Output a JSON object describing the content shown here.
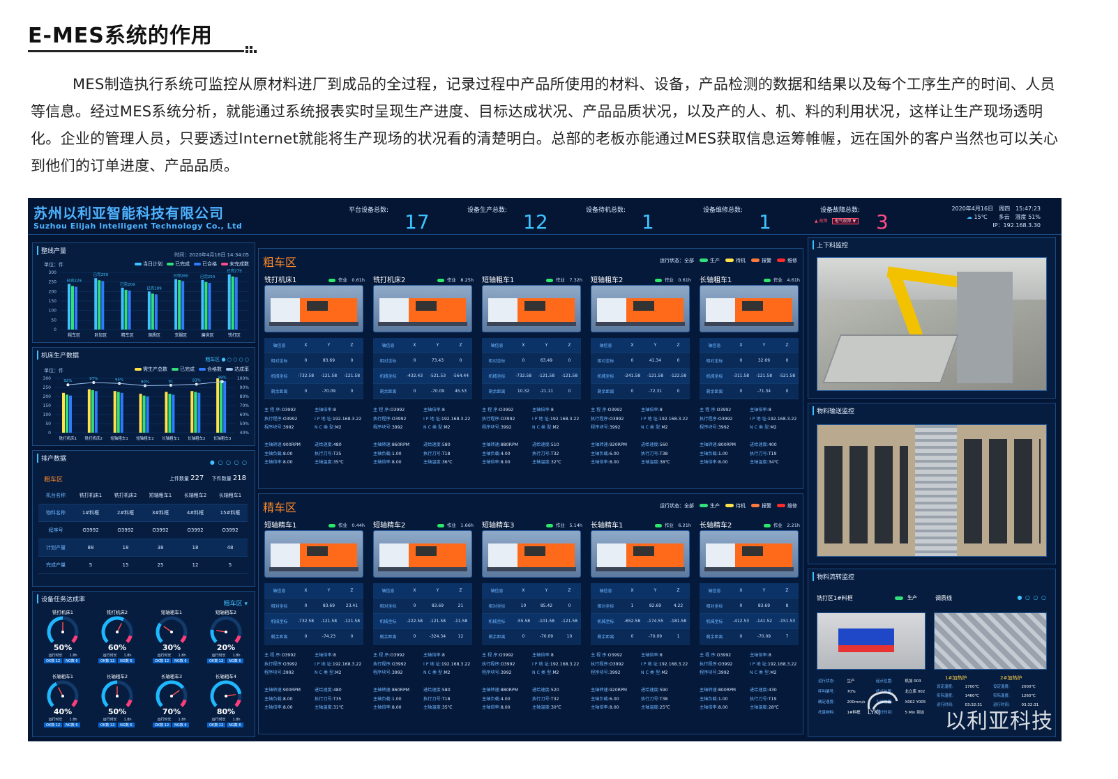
{
  "header": {
    "title": "E-MES系统的作用",
    "paragraph": "MES制造执行系统可监控从原材料进厂到成品的全过程，记录过程中产品所使用的材料、设备，产品检测的数据和结果以及每个工序生产的时间、人员等信息。经过MES系统分析，就能通过系统报表实时呈现生产进度、目标达成状况、产品品质状况，以及产的人、机、料的利用状况，这样让生产现场透明化。企业的管理人员，只要透过Internet就能将生产现场的状况看的清楚明白。总部的老板亦能通过MES获取信息运筹帷幄，远在国外的客户当然也可以关心到他们的订单进度、产品品质。"
  },
  "dashboard": {
    "company_cn": "苏州以利亚智能科技有限公司",
    "company_en": "Suzhou Elijah Intelligent Technology Co., Ltd",
    "stats": [
      {
        "label": "平台设备总数:",
        "value": "17",
        "color": "#3ec3ff"
      },
      {
        "label": "设备生产总数:",
        "value": "12",
        "color": "#3ec3ff"
      },
      {
        "label": "设备待机总数:",
        "value": "1",
        "color": "#3ec3ff"
      },
      {
        "label": "设备维修总数:",
        "value": "1",
        "color": "#3ec3ff"
      },
      {
        "label": "设备故障总数:",
        "value": "3",
        "color": "#ff4d8a"
      }
    ],
    "fault_tag": "故障",
    "fault_sel": "电气故障 ▼",
    "datetime": "2020年4月16日　周四　15:47:23",
    "weather": "15℃　　多云　湿度 51%",
    "ip": "IP：192.168.3.30",
    "output_panel": {
      "title": "整线产量",
      "time": "时间：2020年4月16日 14:34:05",
      "unit": "单位：件",
      "legend": [
        {
          "name": "当日计划",
          "color": "#3ec3ff"
        },
        {
          "name": "已完成",
          "color": "#31e07a"
        },
        {
          "name": "已合格",
          "color": "#2f7bff"
        },
        {
          "name": "未完成数",
          "color": "#ff4d8a"
        }
      ],
      "chart_data": {
        "type": "bar",
        "categories": [
          "粗车区",
          "卧加区",
          "精车区",
          "调质区",
          "支腿区",
          "磨床区",
          "铣打区"
        ],
        "series": [
          {
            "name": "当日计划",
            "values": [
              240,
              270,
              220,
              200,
              265,
              260,
              290
            ]
          },
          {
            "name": "已完成",
            "values": [
              229,
              259,
              209,
              189,
              260,
              250,
              279
            ]
          },
          {
            "name": "已合格",
            "values": [
              225,
              255,
              205,
              185,
              255,
              245,
              275
            ]
          }
        ],
        "labels": [
          "已完229",
          "已完259",
          "已完209",
          "已完189",
          "已完260",
          "已完250",
          "已完279"
        ],
        "yticks": [
          "300",
          "250",
          "200",
          "150",
          "100",
          "50",
          "0"
        ],
        "ylim": [
          0,
          300
        ]
      }
    },
    "machine_panel": {
      "title": "机床生产数据",
      "zone": "粗车区",
      "unit": "单位：件",
      "legend": [
        {
          "name": "需生产总数",
          "color": "#ffe14a"
        },
        {
          "name": "已完成",
          "color": "#31e07a"
        },
        {
          "name": "合格数",
          "color": "#2f7bff"
        },
        {
          "name": "达成率",
          "color": "#9fc3ee"
        }
      ],
      "chart_data": {
        "type": "bar",
        "categories": [
          "铣打机床1",
          "铣打机床2",
          "短轴粗车1",
          "短轴粗车2",
          "长轴粗车1",
          "长轴粗车2",
          "长轴粗车3"
        ],
        "series": [
          {
            "name": "需生产总数",
            "values": [
              220,
              240,
              230,
              215,
              225,
              230,
              300
            ]
          },
          {
            "name": "已完成",
            "values": [
              210,
              235,
              225,
              205,
              215,
              225,
              290
            ]
          },
          {
            "name": "合格数",
            "values": [
              205,
              230,
              220,
              200,
              210,
              220,
              285
            ]
          }
        ],
        "rate": [
          "92%",
          "97%",
          "95%",
          "90%",
          "91",
          "93%",
          "99%"
        ],
        "rate_values": [
          92,
          97,
          95,
          90,
          91,
          93,
          99
        ],
        "yticks": [
          "300",
          "250",
          "200",
          "150",
          "100",
          "50",
          "0"
        ],
        "y2ticks": [
          "100%",
          "90%",
          "80%",
          "70%",
          "60%",
          "50%",
          "40%"
        ]
      }
    },
    "schedule_panel": {
      "title": "排产数据",
      "zone": "粗车区",
      "in_label": "上件数量",
      "in_val": "227",
      "out_label": "下件数量",
      "out_val": "218",
      "rows": [
        [
          "机台名称",
          "铣打机床1",
          "铣打机床2",
          "短轴粗车1",
          "长轴粗车2",
          "长轴粗车1"
        ],
        [
          "物料名称",
          "1#料框",
          "2#料框",
          "3#料框",
          "4#料框",
          "15#料框"
        ],
        [
          "程序号",
          "O3992",
          "O3992",
          "O3992",
          "O3992",
          "O3992"
        ],
        [
          "计划产量",
          "88",
          "18",
          "38",
          "18",
          "48"
        ],
        [
          "完成产量",
          "5",
          "15",
          "25",
          "12",
          "5"
        ]
      ]
    },
    "gauge_panel": {
      "title": "设备任务达成率",
      "zone": "粗车区 ▾",
      "gauges": [
        {
          "name": "铣打机床1",
          "pct": "50%",
          "v": 50
        },
        {
          "name": "铣打机床2",
          "pct": "60%",
          "v": 60
        },
        {
          "name": "短轴粗车1",
          "pct": "30%",
          "v": 30
        },
        {
          "name": "短轴粗车2",
          "pct": "20%",
          "v": 20
        },
        {
          "name": "长轴粗车1",
          "pct": "40%",
          "v": 40
        },
        {
          "name": "长轴粗车2",
          "pct": "50%",
          "v": 50
        },
        {
          "name": "长轴粗车3",
          "pct": "70%",
          "v": 70
        },
        {
          "name": "长轴粗车4",
          "pct": "80%",
          "v": 80
        }
      ],
      "time_text": "运行时长　　1.8h",
      "ok": "OK数 12",
      "ng": "NG数 6"
    },
    "zones": [
      {
        "title": "粗车区",
        "status": "运行状态：全部",
        "leg": [
          {
            "n": "生产",
            "c": "#31e07a"
          },
          {
            "n": "待机",
            "c": "#ffe14a"
          },
          {
            "n": "报警",
            "c": "#ff7a3a"
          },
          {
            "n": "维修",
            "c": "#ff2a2a"
          }
        ],
        "machines": [
          {
            "name": "铣打机床1",
            "state": "作业　0.61h",
            "rel": [
              "0",
              "83.69",
              "0"
            ],
            "mech": [
              "-732.58",
              "-121.58",
              "-121.58"
            ],
            "rem": [
              "0",
              "-70.09",
              "0"
            ],
            "spd": "900RPM",
            "feed": "480",
            "load": "8.00",
            "tool": "T35",
            "rate": "8.00",
            "temp": "35℃"
          },
          {
            "name": "铣打机床2",
            "state": "作业　8.25h",
            "rel": [
              "0",
              "73.43",
              "0"
            ],
            "mech": [
              "-432.43",
              "-521.53",
              "-564.44"
            ],
            "rem": [
              "0",
              "-70.09",
              "45.53"
            ],
            "spd": "860RPM",
            "feed": "580",
            "load": "1.00",
            "tool": "T18",
            "rate": "8.00",
            "temp": "36℃"
          },
          {
            "name": "短轴粗车1",
            "state": "作业　7.32h",
            "rel": [
              "0",
              "63.49",
              "0"
            ],
            "mech": [
              "-732.58",
              "-121.58",
              "-121.58"
            ],
            "rem": [
              "10.32",
              "-21.11",
              "0"
            ],
            "spd": "880RPM",
            "feed": "510",
            "load": "4.00",
            "tool": "T32",
            "rate": "8.00",
            "temp": "32℃"
          },
          {
            "name": "短轴粗车2",
            "state": "作业　0.61h",
            "rel": [
              "0",
              "41.34",
              "0"
            ],
            "mech": [
              "-241.58",
              "-121.58",
              "-122.58"
            ],
            "rem": [
              "0",
              "-72.31",
              "0"
            ],
            "spd": "920RPM",
            "feed": "560",
            "load": "6.00",
            "tool": "T38",
            "rate": "8.00",
            "temp": "38℃"
          },
          {
            "name": "长轴粗车1",
            "state": "作业　4.61h",
            "rel": [
              "0",
              "32.69",
              "0"
            ],
            "mech": [
              "-311.58",
              "-121.58",
              "-521.58"
            ],
            "rem": [
              "0",
              "-71.34",
              "0"
            ],
            "spd": "800RPM",
            "feed": "400",
            "load": "1.00",
            "tool": "T19",
            "rate": "8.00",
            "temp": "34℃"
          }
        ]
      },
      {
        "title": "精车区",
        "status": "运行状态：全部",
        "leg": [
          {
            "n": "生产",
            "c": "#31e07a"
          },
          {
            "n": "待机",
            "c": "#ffe14a"
          },
          {
            "n": "报警",
            "c": "#ff7a3a"
          },
          {
            "n": "维修",
            "c": "#ff2a2a"
          }
        ],
        "machines": [
          {
            "name": "短轴精车1",
            "state": "作业　0.44h",
            "rel": [
              "0",
              "83.69",
              "23.41"
            ],
            "mech": [
              "-732.58",
              "-121.58",
              "-121.58"
            ],
            "rem": [
              "0",
              "-74.23",
              "0"
            ],
            "spd": "900RPM",
            "feed": "480",
            "load": "8.00",
            "tool": "T35",
            "rate": "8.00",
            "temp": "31℃"
          },
          {
            "name": "短轴精车2",
            "state": "作业　1.66h",
            "rel": [
              "0",
              "83.69",
              "21"
            ],
            "mech": [
              "-222.58",
              "-121.58",
              "-11.58"
            ],
            "rem": [
              "0",
              "-324.34",
              "12"
            ],
            "spd": "860RPM",
            "feed": "580",
            "load": "1.00",
            "tool": "T18",
            "rate": "8.00",
            "temp": "35℃"
          },
          {
            "name": "短轴精车3",
            "state": "作业　5.14h",
            "rel": [
              "10",
              "85.42",
              "0"
            ],
            "mech": [
              "-55.58",
              "-101.58",
              "-121.58"
            ],
            "rem": [
              "0",
              "-70.09",
              "10"
            ],
            "spd": "880RPM",
            "feed": "520",
            "load": "4.00",
            "tool": "T32",
            "rate": "8.00",
            "temp": "30℃"
          },
          {
            "name": "长轴精车1",
            "state": "作业　6.21h",
            "rel": [
              "1",
              "82.69",
              "4.22"
            ],
            "mech": [
              "-652.58",
              "-174.55",
              "-181.58"
            ],
            "rem": [
              "0",
              "-70.09",
              "1"
            ],
            "spd": "920RPM",
            "feed": "590",
            "load": "6.00",
            "tool": "T38",
            "rate": "8.00",
            "temp": "25℃"
          },
          {
            "name": "长轴精车2",
            "state": "作业　2.21h",
            "rel": [
              "0",
              "83.69",
              "8"
            ],
            "mech": [
              "-412.53",
              "-141.52",
              "-151.53"
            ],
            "rem": [
              "0",
              "-70.09",
              "7"
            ],
            "spd": "800RPM",
            "feed": "430",
            "load": "1.00",
            "tool": "T19",
            "rate": "8.00",
            "temp": "28℃"
          }
        ]
      }
    ],
    "grid_head": [
      "轴信息",
      "X",
      "Y",
      "Z"
    ],
    "grid_rows": [
      "相对坐标",
      "机械坐标",
      "剩余距离"
    ],
    "info_labels": {
      "prog": "主 程 序:",
      "prog_v": "O3992",
      "spn": "主轴倍率:",
      "spn_v": "8",
      "exec": "执行程序:",
      "exec_v": "O3992",
      "ip": "I P 地 址:",
      "ip_v": "192.168.3.22",
      "blk": "程序块号:",
      "blk_v": "3992",
      "nc": "N C 类 型:",
      "nc_v": "M2",
      "spd": "主轴转速:",
      "feed": "进给速度:",
      "load": "主轴负载:",
      "tool": "执行刀号:",
      "rate": "主轴倍率:",
      "temp": "主轴温度:"
    },
    "right": {
      "cam1": "上下料监控",
      "cam2": "物料输送监控",
      "flow": "物料流转监控",
      "flow_sub": "铣打区1#料框",
      "flow_state": "生产",
      "flow_line": "调质线",
      "flow_info": [
        [
          "运行状态:",
          "生产",
          "起点位置:",
          "机加 003"
        ],
        [
          "呼叫编号:",
          "70%",
          "终点位置:",
          "北立库 002"
        ],
        [
          "确定速度:",
          "200mm/s",
          "当前位置:",
          "X002 Y005"
        ],
        [
          "托盘物料:",
          "1#料框",
          "预计时间:",
          "5 Min 到达"
        ]
      ],
      "furnace1": "1#加热炉",
      "furnace2": "2#加热炉",
      "f_rows": [
        [
          "设定温度:",
          "1700℃",
          "设定温度:",
          "2000℃"
        ],
        [
          "实际温度:",
          "1460℃",
          "实际温度:",
          "1260℃"
        ],
        [
          "运行时间:",
          "03:32:31",
          "运行时间:",
          "03:32:31"
        ]
      ]
    },
    "watermark": "以利亚科技",
    "logo_text": "LYKJ"
  }
}
